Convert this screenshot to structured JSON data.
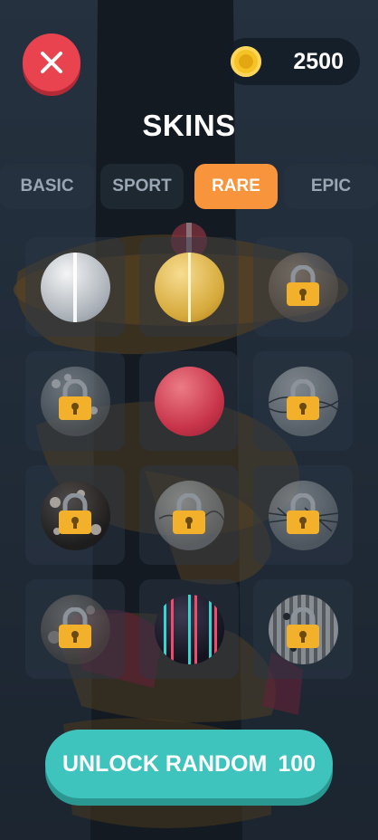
{
  "header": {
    "close_icon": "close-icon",
    "coin_icon": "coin-icon",
    "coins": "2500"
  },
  "title": "SKINS",
  "tabs": [
    {
      "label": "BASIC",
      "active": false
    },
    {
      "label": "SPORT",
      "active": false
    },
    {
      "label": "RARE",
      "active": true
    },
    {
      "label": "EPIC",
      "active": false
    }
  ],
  "skins": [
    {
      "name": "silver-stripe",
      "locked": false
    },
    {
      "name": "gold-stripe",
      "locked": false
    },
    {
      "name": "rocky",
      "locked": true
    },
    {
      "name": "spotted",
      "locked": true
    },
    {
      "name": "crimson",
      "locked": false
    },
    {
      "name": "net",
      "locked": true
    },
    {
      "name": "bokeh",
      "locked": true
    },
    {
      "name": "scribble",
      "locked": true
    },
    {
      "name": "grid-net",
      "locked": true
    },
    {
      "name": "marble",
      "locked": true
    },
    {
      "name": "neon-stripes",
      "locked": false
    },
    {
      "name": "striped-spots",
      "locked": true
    }
  ],
  "unlock": {
    "label": "UNLOCK RANDOM",
    "price": "100"
  },
  "colors": {
    "accent": "#f8943b",
    "close": "#e8434f",
    "unlock": "#3ec4bd",
    "coin": "#f6c327"
  }
}
